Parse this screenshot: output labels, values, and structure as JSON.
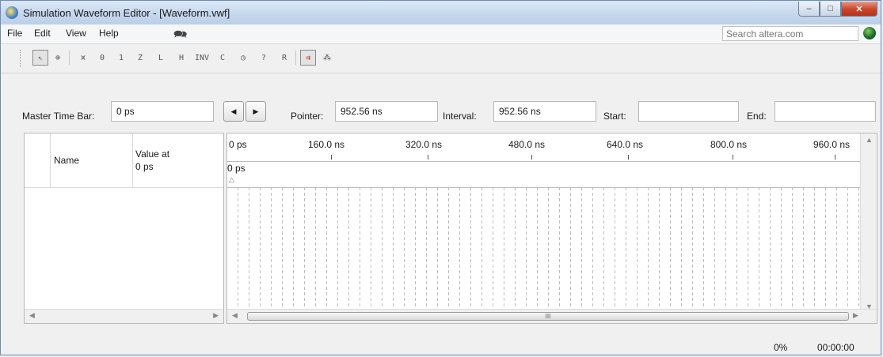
{
  "window": {
    "title": "Simulation Waveform Editor - [Waveform.vwf]",
    "minimize": "–",
    "maximize": "□",
    "close": "✕"
  },
  "menu": {
    "items": [
      "File",
      "Edit",
      "View",
      "Help"
    ],
    "search_placeholder": "Search altera.com"
  },
  "toolbar": {
    "tools": [
      {
        "name": "selection-tool-icon",
        "glyph": "⇖",
        "state": "selected"
      },
      {
        "name": "zoom-tool-icon",
        "glyph": "⊕"
      },
      {
        "name": "uninitialized-value-icon",
        "glyph": "⩙"
      },
      {
        "name": "forcing-low-icon",
        "glyph": "0"
      },
      {
        "name": "forcing-high-icon",
        "glyph": "1"
      },
      {
        "name": "high-impedance-icon",
        "glyph": "Z"
      },
      {
        "name": "weak-low-icon",
        "glyph": "L"
      },
      {
        "name": "weak-high-icon",
        "glyph": "H"
      },
      {
        "name": "invert-icon",
        "glyph": "INV"
      },
      {
        "name": "count-value-icon",
        "glyph": "C"
      },
      {
        "name": "clock-value-icon",
        "glyph": "◷"
      },
      {
        "name": "arbitrary-value-icon",
        "glyph": "?"
      },
      {
        "name": "random-value-icon",
        "glyph": "R"
      },
      {
        "name": "snap-to-grid-icon",
        "glyph": "⇉",
        "state": "active"
      },
      {
        "name": "grid-settings-icon",
        "glyph": "⁂"
      }
    ]
  },
  "timebar": {
    "master_label": "Master Time Bar:",
    "master_value": "0 ps",
    "prev_glyph": "◀",
    "next_glyph": "▶",
    "pointer_label": "Pointer:",
    "pointer_value": "952.56 ns",
    "interval_label": "Interval:",
    "interval_value": "952.56 ns",
    "start_label": "Start:",
    "start_value": "",
    "end_label": "End:",
    "end_value": ""
  },
  "signals": {
    "col_name": "Name",
    "col_value_line1": "Value at",
    "col_value_line2": "0 ps",
    "rows": []
  },
  "waveform": {
    "ticks": [
      "0 ps",
      "160.0 ns",
      "320.0 ns",
      "480.0 ns",
      "640.0 ns",
      "800.0 ns",
      "960.0 ns"
    ],
    "master_bar_label": "0 ps",
    "scroll_label": "III"
  },
  "status": {
    "progress": "0%",
    "elapsed": "00:00:00"
  },
  "colors": {
    "title_bar": "#c6d8ee",
    "close_button": "#c9442b",
    "frame_border": "#6f8bb1"
  }
}
